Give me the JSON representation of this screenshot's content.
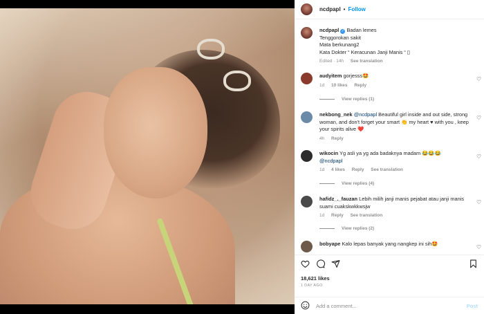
{
  "post": {
    "username": "ncdpapl",
    "follow_label": "Follow",
    "dot": "•",
    "caption_lines": [
      "Badan lemes",
      "Tenggorokan sakit",
      "Mata berkunang2",
      "Kata Dokter “ Keracunan Janji Manis “ ▯"
    ],
    "caption_meta": {
      "edited": "Edited · 14h",
      "see_translation": "See translation"
    }
  },
  "comments": [
    {
      "username": "audyitem",
      "text": "gorjesss🤩",
      "time": "1d",
      "likes": "10 likes",
      "reply": "Reply",
      "view_replies": "View replies (1)",
      "avatar_color": "#8a3b2c"
    },
    {
      "username": "nekbong_nek",
      "mention": "@ncdpapl",
      "text": " Beautiful girl inside and out side, strong woman, and don't forget your smart 👏 my heart ♥ with you , keep your spirits alive ❤️",
      "time": "4h",
      "reply": "Reply",
      "avatar_color": "#6b8aa8"
    },
    {
      "username": "wikocin",
      "text": "Yg asli ya yg ada badaknya madam 😂😂😂 ",
      "mention": "@ncdpapl",
      "time": "1d",
      "likes": "4 likes",
      "reply": "Reply",
      "see_translation": "See translation",
      "view_replies": "View replies (4)",
      "avatar_color": "#2b2b2b"
    },
    {
      "username": "hafidz_._fauzan",
      "text": "Lebih milih janji manis pejabat atau janji manis suami cuakskwkkwsjw",
      "time": "1d",
      "reply": "Reply",
      "see_translation": "See translation",
      "view_replies": "View replies (2)",
      "avatar_color": "#4a4a4a"
    },
    {
      "username": "bobyape",
      "text": "Kalo lepas banyak yang nangkep ini sih🤩",
      "avatar_color": "#6e5a4b"
    }
  ],
  "footer": {
    "likes": "18,621 likes",
    "ago": "1 DAY AGO",
    "comment_placeholder": "Add a comment...",
    "post_label": "Post"
  },
  "icons": [
    "heart-icon",
    "comment-icon",
    "share-icon",
    "bookmark-icon",
    "emoji-icon",
    "verified-icon"
  ],
  "colors": {
    "accent": "#0095f6",
    "muted": "#8e8e8e",
    "verified": "#3897f0"
  }
}
